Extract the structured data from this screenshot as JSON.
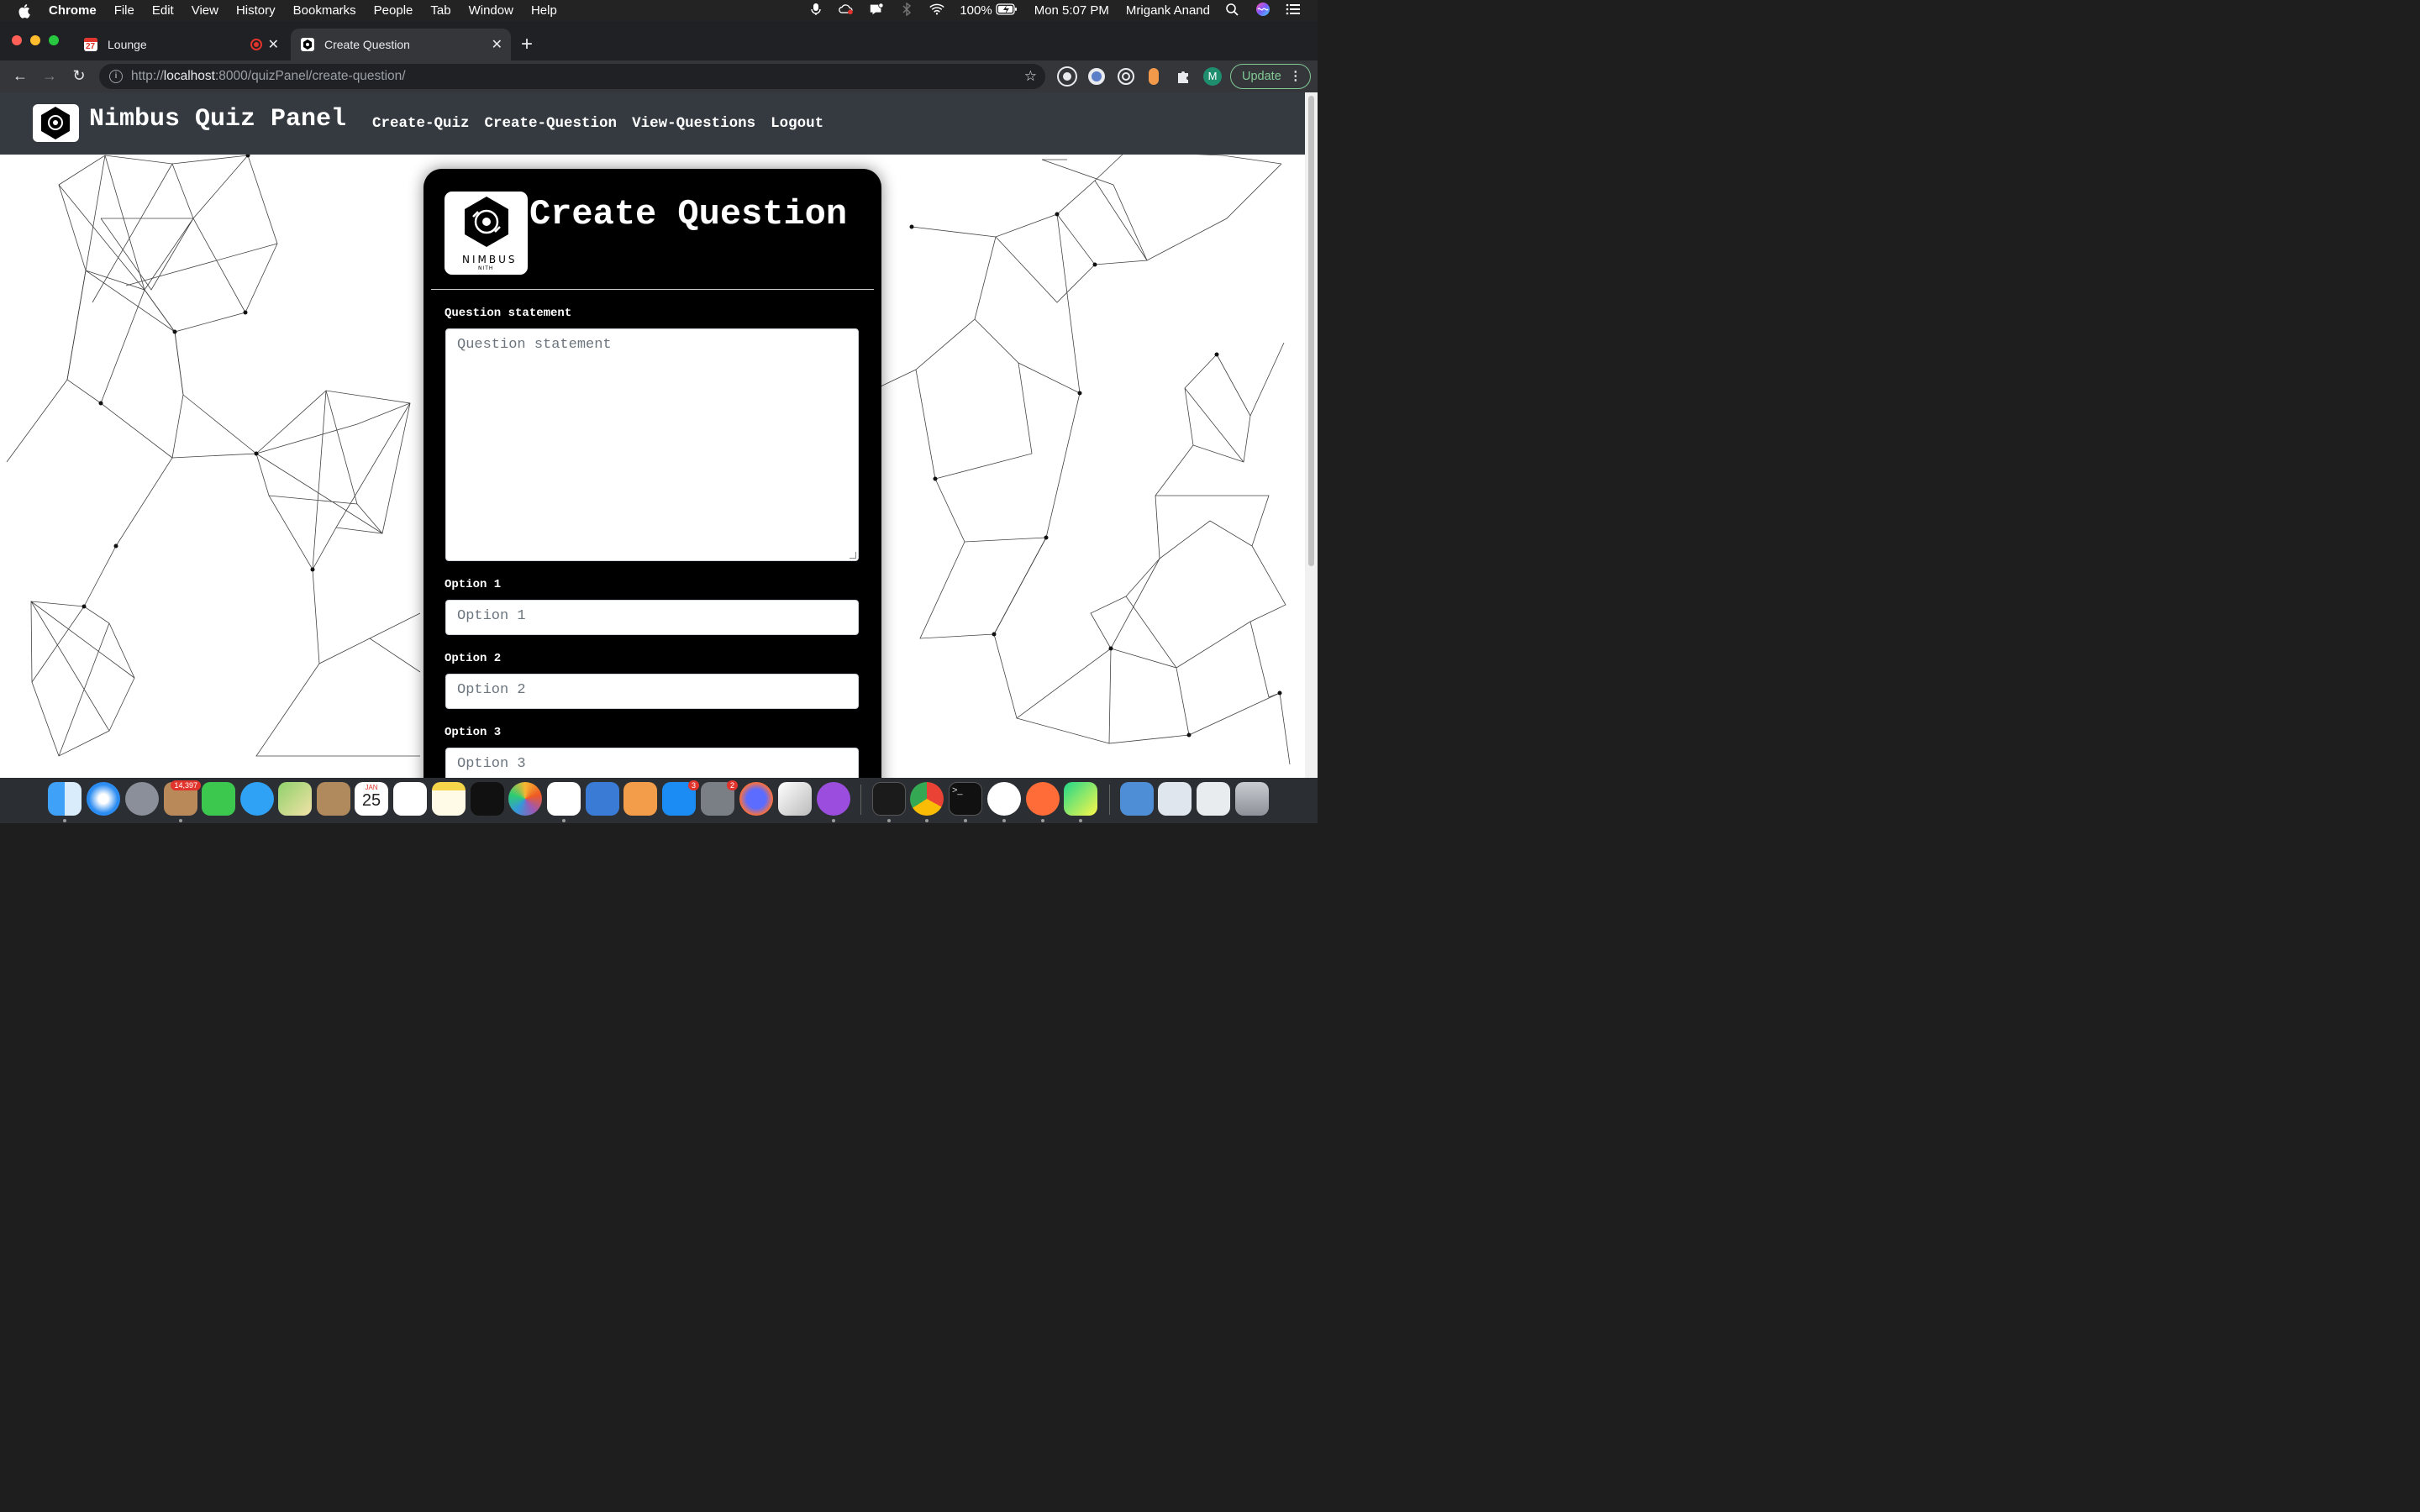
{
  "menubar": {
    "app": "Chrome",
    "items": [
      "File",
      "Edit",
      "View",
      "History",
      "Bookmarks",
      "People",
      "Tab",
      "Window",
      "Help"
    ],
    "battery": "100%",
    "clock": "Mon 5:07 PM",
    "user": "Mrigank Anand"
  },
  "tabs": [
    {
      "title": "Lounge",
      "icon": "calendar-icon",
      "recording": true
    },
    {
      "title": "Create Question",
      "icon": "nimbus-favicon",
      "active": true
    }
  ],
  "address": {
    "prefix": "http://",
    "host": "localhost",
    "rest": ":8000/quizPanel/create-question/"
  },
  "toolbar": {
    "update_label": "Update",
    "profile_initial": "M"
  },
  "site": {
    "brand": "Nimbus Quiz Panel",
    "nav": [
      "Create-Quiz",
      "Create-Question",
      "View-Questions",
      "Logout"
    ]
  },
  "form": {
    "title": "Create Question",
    "logo_text": "NIMBUS",
    "logo_subtext": "NITH",
    "fields": [
      {
        "label": "Question statement",
        "placeholder": "Question statement",
        "type": "textarea"
      },
      {
        "label": "Option 1",
        "placeholder": "Option 1",
        "type": "input"
      },
      {
        "label": "Option 2",
        "placeholder": "Option 2",
        "type": "input"
      },
      {
        "label": "Option 3",
        "placeholder": "Option 3",
        "type": "input"
      }
    ]
  },
  "dock": {
    "badges": {
      "mail": "14,397",
      "appstore": "3",
      "prefs": "2"
    },
    "calendar_month": "JAN",
    "calendar_day": "25"
  },
  "colors": {
    "navbar": "#343a40",
    "card": "#000000",
    "update_green": "#81c995"
  }
}
